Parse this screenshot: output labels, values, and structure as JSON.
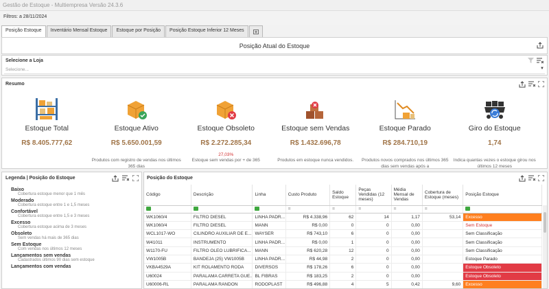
{
  "window": {
    "title": "Gestão de Estoque - Multiempresa Versão 24.3.6"
  },
  "filters": {
    "text": "Filtros:  a 28/11/2024"
  },
  "tabs": [
    {
      "label": "Posição Estoque",
      "active": true
    },
    {
      "label": "Inventário Mensal Estoque",
      "active": false
    },
    {
      "label": "Estoque por Posição",
      "active": false
    },
    {
      "label": "Posição Estoque Inferior 12 Meses",
      "active": false
    }
  ],
  "header": {
    "title": "Posição Atual do Estoque"
  },
  "store": {
    "label": "Selecione a Loja",
    "placeholder": "Selecione..."
  },
  "summary": {
    "label": "Resumo",
    "kpis": [
      {
        "icon": "shelves-icon",
        "name": "Estoque Total",
        "value": "R$ 8.405.777,62",
        "pct": "",
        "desc": ""
      },
      {
        "icon": "box-check-icon",
        "name": "Estoque Ativo",
        "value": "R$ 5.650.001,59",
        "pct": "",
        "desc": "Produtos com registro de vendas nos últimos 365 dias"
      },
      {
        "icon": "box-x-icon",
        "name": "Estoque Obsoleto",
        "value": "R$ 2.272.285,34",
        "pct": "27,03%",
        "desc": "Estoque sem vendas por + de 365"
      },
      {
        "icon": "boxes-x-icon",
        "name": "Estoque sem Vendas",
        "value": "R$ 1.432.696,78",
        "pct": "",
        "desc": "Produtos em estoque nunca vendidos."
      },
      {
        "icon": "stopped-chart-icon",
        "name": "Estoque Parado",
        "value": "R$ 284.710,19",
        "pct": "",
        "desc": "Produtos novos comprados nos últimos 365 dias sem vendas após a"
      },
      {
        "icon": "rotation-cart-icon",
        "name": "Giro do Estoque",
        "value": "1,74",
        "pct": "",
        "desc": "Indica quantas vezes o estoque girou nos últimos 12 meses"
      }
    ]
  },
  "legend": {
    "label": "Legenda | Posição do Estoque",
    "items": [
      {
        "name": "Baixo",
        "desc": "Cobertura estoque menor que 1 mês"
      },
      {
        "name": "Moderado",
        "desc": "Cobertura estoque entre 1 e 1,5 meses"
      },
      {
        "name": "Confortável",
        "desc": "Cobertura estoque entre 1,5 e 3 meses"
      },
      {
        "name": "Excesso",
        "desc": "Cobertura estoque acima de 3 meses"
      },
      {
        "name": "Obsoleto",
        "desc": "Sem vendas há mais de 365 dias"
      },
      {
        "name": "Sem Estoque",
        "desc": "Com vendas nos últimos 12 meses"
      },
      {
        "name": "Lançamentos sem vendas",
        "desc": "Cadastrados últimos 90 dias sem estoque"
      },
      {
        "name": "Lançamentos com vendas",
        "desc": ""
      }
    ]
  },
  "grid": {
    "label": "Posição do Estoque",
    "columns": [
      "Código",
      "Descrição",
      "Linha",
      "Custo Produto",
      "Saldo Estoque",
      "Peças Vendidas (12 meses)",
      "Média Mensal de Vendas",
      "Cobertura de Estoque (meses)",
      "Posição Estoque"
    ],
    "rows": [
      [
        "WK1060/4",
        "FILTRO DIESEL",
        "LINHA PADR...",
        "R$ 4.338,96",
        "62",
        "14",
        "1,17",
        "53,14",
        "Excesso"
      ],
      [
        "WK1060/4",
        "FILTRO DIESEL",
        "MANN",
        "R$ 0,00",
        "0",
        "0",
        "0,00",
        "",
        "Sem Estoque"
      ],
      [
        "WCL1017-WO",
        "CILINDRO AUXILIAR DE E...",
        "WAYSER",
        "R$ 743,10",
        "6",
        "0",
        "0,00",
        "",
        "Sem Classificação"
      ],
      [
        "W41011",
        "INSTRUMENTO",
        "LINHA PADR...",
        "R$ 0,00",
        "1",
        "0",
        "0,00",
        "",
        "Sem Classificação"
      ],
      [
        "W1170-FU",
        "FILTRO OLEO LUBRIFICA...",
        "MANN",
        "R$ 620,28",
        "12",
        "0",
        "0,00",
        "",
        "Sem Classificação"
      ],
      [
        "VW1005B",
        "BANDEJA (25) VW1005B",
        "LINHA PADR...",
        "R$ 44,98",
        "2",
        "0",
        "0,00",
        "",
        "Estoque Parado"
      ],
      [
        "VKBA4529A",
        "KIT ROLAMENTO RODA",
        "DIVERSOS",
        "R$ 178,26",
        "6",
        "0",
        "0,00",
        "",
        "Estoque Obsoleto"
      ],
      [
        "U60024",
        "PARALAMA CARRETA GUE...",
        "BL FIBRAS",
        "R$ 183,25",
        "2",
        "0",
        "0,00",
        "",
        "Estoque Obsoleto"
      ],
      [
        "U60006-RL",
        "PARALAMA RANDON",
        "RODOPLAST",
        "R$ 496,88",
        "4",
        "5",
        "0,42",
        "9,60",
        "Excesso"
      ],
      [
        "U60006-RL",
        "PARALAMA RANDON",
        "RODOPLAST",
        "",
        "",
        "",
        "",
        "",
        ""
      ]
    ]
  },
  "colors": {
    "excesso": "#ff7f1f",
    "obsoleto": "#e23b45",
    "value": "#a07447"
  }
}
